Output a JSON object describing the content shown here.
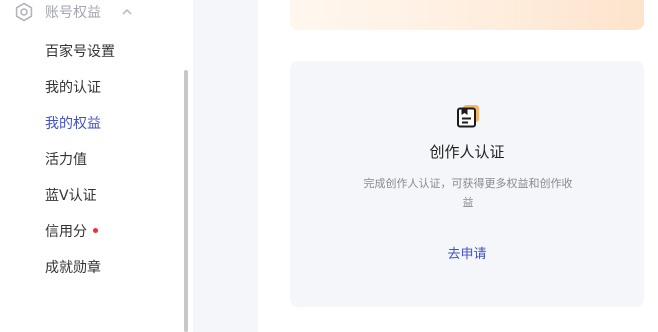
{
  "sidebar": {
    "section_title": "账号权益",
    "items": [
      {
        "label": "百家号设置",
        "active": false,
        "badge": false
      },
      {
        "label": "我的认证",
        "active": false,
        "badge": false
      },
      {
        "label": "我的权益",
        "active": true,
        "badge": false
      },
      {
        "label": "活力值",
        "active": false,
        "badge": false
      },
      {
        "label": "蓝V认证",
        "active": false,
        "badge": false
      },
      {
        "label": "信用分",
        "active": false,
        "badge": true
      },
      {
        "label": "成就勋章",
        "active": false,
        "badge": false
      }
    ]
  },
  "card": {
    "title": "创作人认证",
    "description": "完成创作人认证，可获得更多权益和创作收益",
    "action_label": "去申请"
  },
  "icons": {
    "section": "gear-icon",
    "collapse": "chevron-up-icon",
    "card": "certificate-icon",
    "badge": "red-dot"
  },
  "colors": {
    "accent": "#4151c9",
    "badge": "#f02d3c",
    "icon_highlight": "#f6b66a"
  }
}
